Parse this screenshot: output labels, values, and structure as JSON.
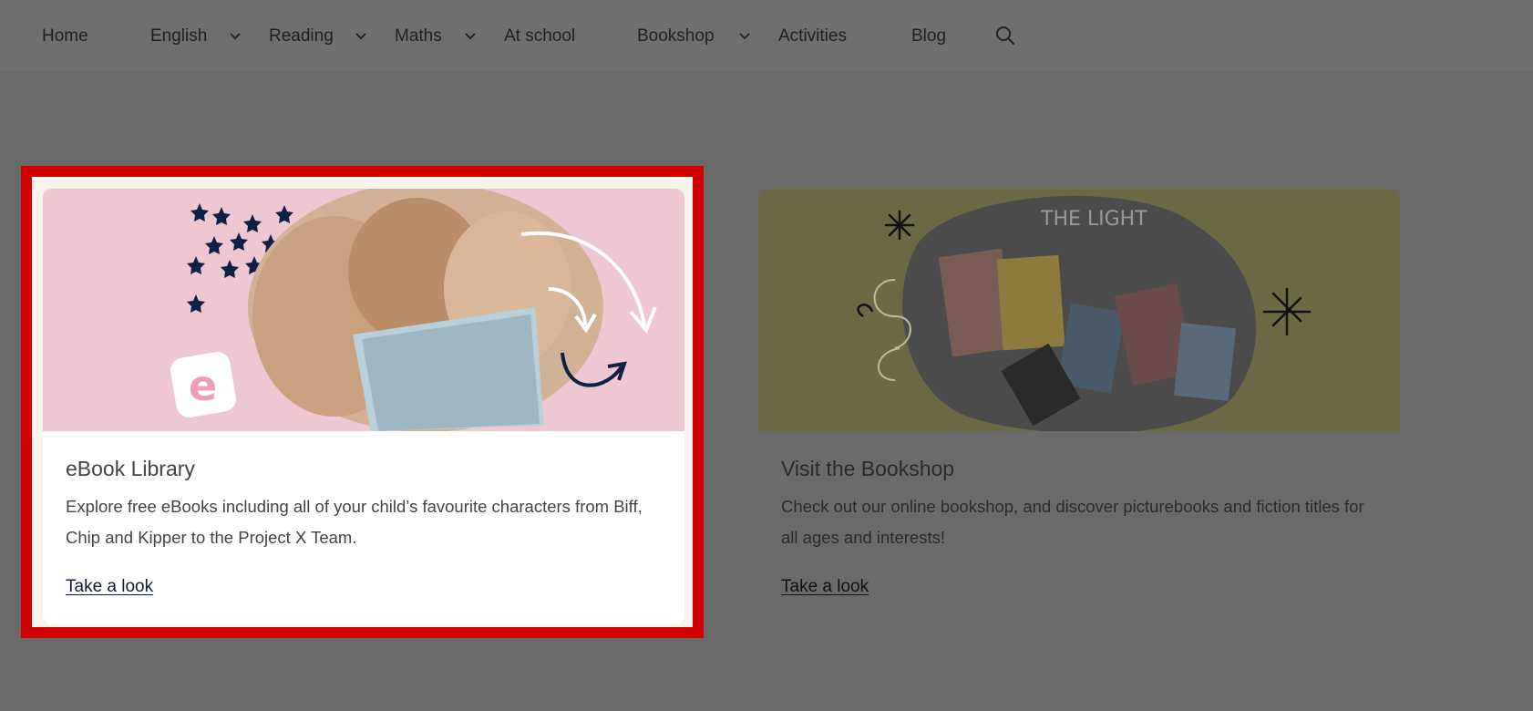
{
  "nav": {
    "items": [
      {
        "label": "Home",
        "dropdown": false
      },
      {
        "label": "English",
        "dropdown": true
      },
      {
        "label": "Reading",
        "dropdown": true
      },
      {
        "label": "Maths",
        "dropdown": true
      },
      {
        "label": "At school",
        "dropdown": false
      },
      {
        "label": "Bookshop",
        "dropdown": true
      },
      {
        "label": "Activities",
        "dropdown": false
      },
      {
        "label": "Blog",
        "dropdown": false
      }
    ],
    "search_icon": "search-icon"
  },
  "cards": [
    {
      "title": "eBook Library",
      "description": "Explore free eBooks including all of your child’s favourite characters from Biff, Chip and Kipper to the Project X Team.",
      "link": "Take a look",
      "highlighted": true
    },
    {
      "title": "Visit the Bookshop",
      "description": "Check out our online bookshop, and discover picturebooks and fiction titles for all ages and interests!",
      "link": "Take a look",
      "highlighted": false
    }
  ],
  "colors": {
    "highlight": "#d10000",
    "ebook_bg": "#efc7d2",
    "bookshop_bg": "#6b6a44",
    "overlay": "#6a6a6a"
  }
}
